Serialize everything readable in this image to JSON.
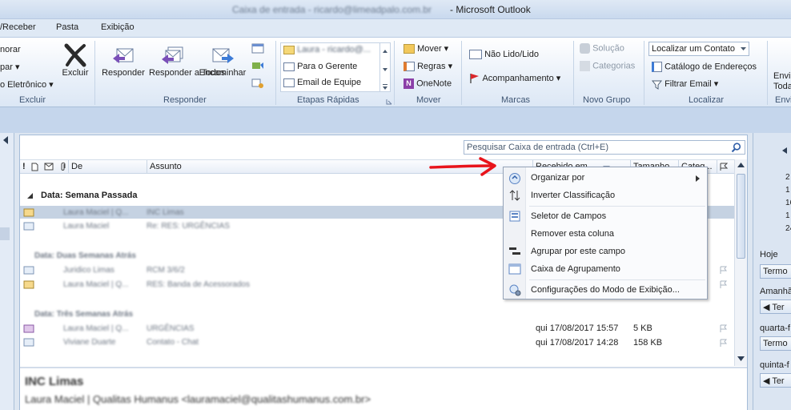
{
  "window": {
    "title_blurred": "Caixa de entrada - ricardo@limeadpalo.com.br",
    "app_name": "- Microsoft Outlook"
  },
  "tabs": [
    "/Receber",
    "Pasta",
    "Exibição"
  ],
  "ribbon": {
    "excluir_group": {
      "items": [
        "norar",
        "par ▾",
        "o Eletrônico ▾"
      ],
      "delete_label": "Excluir",
      "group_label": "Excluir"
    },
    "responder_group": {
      "reply_label": "Responder",
      "reply_all_label": "Responder a Todos",
      "forward_label": "Encaminhar",
      "group_label": "Responder"
    },
    "etapas_group": {
      "quick_steps": [
        "Laura - ricardo@...",
        "Para o Gerente",
        "Email de Equipe"
      ],
      "group_label": "Etapas Rápidas"
    },
    "mover_group": {
      "items": [
        "Mover ▾",
        "Regras ▾",
        "OneNote"
      ],
      "group_label": "Mover"
    },
    "marcas_group": {
      "items": [
        "Não Lido/Lido",
        "Acompanhamento ▾"
      ],
      "group_label": "Marcas"
    },
    "novo_grupo": {
      "items": [
        "Solução",
        "Categorias"
      ],
      "group_label": "Novo Grupo"
    },
    "localizar_group": {
      "contact_placeholder": "Localizar um Contato",
      "items": [
        "Catálogo de Endereços",
        "Filtrar Email ▾"
      ],
      "group_label": "Localizar"
    },
    "enviar_group": {
      "items": [
        "Envi",
        "Toda"
      ],
      "group_label": "Envi"
    }
  },
  "search": {
    "placeholder": "Pesquisar Caixa de entrada (Ctrl+E)"
  },
  "columns": {
    "from": "De",
    "subject": "Assunto",
    "received": "Recebido em",
    "size": "Tamanho",
    "categories": "Categ..."
  },
  "groups": [
    {
      "label": "Data: Semana Passada",
      "blurred": false
    },
    {
      "label": "Data: Duas Semanas Atrás",
      "blurred": true
    },
    {
      "label": "Data: Três Semanas Atrás",
      "blurred": true
    }
  ],
  "messages_blurred": [
    {
      "from": "Laura Maciel | Q...",
      "subject": "INC Limas"
    },
    {
      "from": "Laura Maciel",
      "subject": "Re: RES: URGÊNCIAS"
    },
    {
      "from": "Juridico Limas",
      "subject": "RCM 3/6/2"
    },
    {
      "from": "Laura Maciel | Q...",
      "subject": "RES: Banda de Acessorados"
    },
    {
      "from": "Laura Maciel | Q...",
      "subject": "URGÊNCIAS"
    },
    {
      "from": "Viviane Duarte",
      "subject": "Contato - Chat"
    }
  ],
  "visible_rows": [
    {
      "received": "qui 17/08/2017 15:57",
      "size": "5 KB"
    },
    {
      "received": "qui 17/08/2017 14:28",
      "size": "158 KB"
    }
  ],
  "preview": {
    "subject": "INC Limas",
    "from": "Laura Maciel | Qualitas Humanus <lauramaciel@qualitashumanus.com.br>"
  },
  "context_menu": {
    "items": [
      "Organizar por",
      "Inverter Classificação",
      "Seletor de Campos",
      "Remover esta coluna",
      "Agrupar por este campo",
      "Caixa de Agrupamento",
      "Configurações do Modo de Exibição..."
    ]
  },
  "todo_bar": {
    "numbers": [
      "2",
      "1",
      "16",
      "1",
      "24"
    ],
    "sections": [
      {
        "label": "Hoje",
        "button": "Termo"
      },
      {
        "label": "Amanhã",
        "button": "◀ Ter"
      },
      {
        "label": "quarta-f",
        "button": "Termo"
      },
      {
        "label": "quinta-f",
        "button": "◀ Ter"
      }
    ]
  },
  "colors": {
    "accent": "#1e395b",
    "selection": "#c5d2e2",
    "red_arrow": "#e8141b"
  }
}
